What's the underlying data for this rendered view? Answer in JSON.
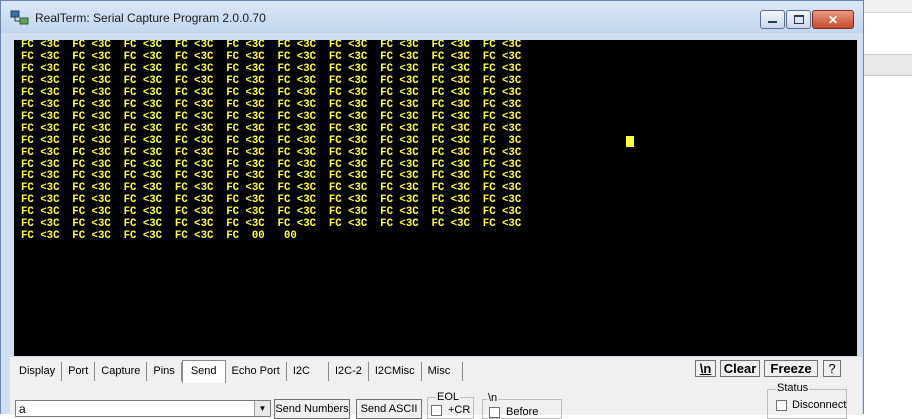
{
  "window": {
    "title": "RealTerm: Serial Capture Program 2.0.0.70",
    "controls": [
      "minimize",
      "maximize",
      "close"
    ]
  },
  "terminal": {
    "lines": [
      "FC <3C  FC <3C  FC <3C  FC <3C  FC <3C  FC <3C  FC <3C  FC <3C  FC <3C  FC <3C",
      "FC <3C  FC <3C  FC <3C  FC <3C  FC <3C  FC <3C  FC <3C  FC <3C  FC <3C  FC <3C",
      "FC <3C  FC <3C  FC <3C  FC <3C  FC <3C  FC <3C  FC <3C  FC <3C  FC <3C  FC <3C",
      "FC <3C  FC <3C  FC <3C  FC <3C  FC <3C  FC <3C  FC <3C  FC <3C  FC <3C  FC <3C",
      "FC <3C  FC <3C  FC <3C  FC <3C  FC <3C  FC <3C  FC <3C  FC <3C  FC <3C  FC <3C",
      "FC <3C  FC <3C  FC <3C  FC <3C  FC <3C  FC <3C  FC <3C  FC <3C  FC <3C  FC <3C",
      "FC <3C  FC <3C  FC <3C  FC <3C  FC <3C  FC <3C  FC <3C  FC <3C  FC <3C  FC <3C",
      "FC <3C  FC <3C  FC <3C  FC <3C  FC <3C  FC <3C  FC <3C  FC <3C  FC <3C  FC <3C",
      "FC <3C  FC <3C  FC <3C  FC <3C  FC <3C  FC <3C  FC <3C  FC <3C  FC <3C  FC  3C",
      "FC <3C  FC <3C  FC <3C  FC <3C  FC <3C  FC <3C  FC <3C  FC <3C  FC <3C  FC <3C",
      "FC <3C  FC <3C  FC <3C  FC <3C  FC <3C  FC <3C  FC <3C  FC <3C  FC <3C  FC <3C",
      "FC <3C  FC <3C  FC <3C  FC <3C  FC <3C  FC <3C  FC <3C  FC <3C  FC <3C  FC <3C",
      "FC <3C  FC <3C  FC <3C  FC <3C  FC <3C  FC <3C  FC <3C  FC <3C  FC <3C  FC <3C",
      "FC <3C  FC <3C  FC <3C  FC <3C  FC <3C  FC <3C  FC <3C  FC <3C  FC <3C  FC <3C",
      "FC <3C  FC <3C  FC <3C  FC <3C  FC <3C  FC <3C  FC <3C  FC <3C  FC <3C  FC <3C",
      "FC <3C  FC <3C  FC <3C  FC <3C  FC <3C  FC <3C  FC <3C  FC <3C  FC <3C  FC <3C",
      "FC <3C  FC <3C  FC <3C  FC <3C  FC  00   00"
    ],
    "text_color": "#ffff33",
    "background": "#000000"
  },
  "tabs": [
    "Display",
    "Port",
    "Capture",
    "Pins",
    "Send",
    "Echo Port",
    "I2C",
    "I2C-2",
    "I2CMisc",
    "Misc"
  ],
  "active_tab": "Send",
  "toolbar": {
    "newline_label": "\\n",
    "clear_label": "Clear",
    "freeze_label": "Freeze",
    "help_label": "?"
  },
  "send": {
    "input_value": "a",
    "send_numbers_label": "Send Numbers",
    "send_ascii_label": "Send ASCII",
    "eol_label": "EOL",
    "cr_label": "+CR",
    "newline_group_label": "\\n",
    "before_label": "Before"
  },
  "status": {
    "legend": "Status",
    "disconnect_label": "Disconnect"
  }
}
